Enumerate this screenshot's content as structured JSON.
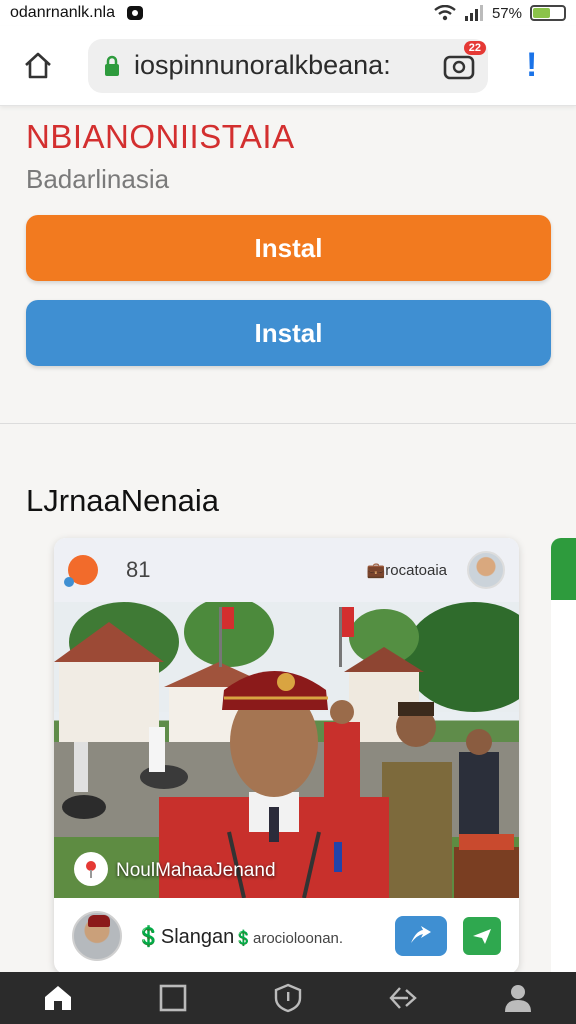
{
  "status_bar": {
    "left_text": "odanrnanlk.nla",
    "battery_text": "57%",
    "battery_level": 0.57
  },
  "browser": {
    "url": "iospinnunoralkbeana:",
    "tab_count": "22",
    "menu_glyph": "!"
  },
  "page": {
    "title": "NBIANONIISTAIA",
    "subtitle": "Badarlinasia",
    "install_orange_label": "Instal",
    "install_blue_label": "Instal",
    "section_title": "LJrnaaNenaia"
  },
  "card": {
    "count": "81",
    "tag": "💼rocatoaia",
    "photo_caption": "NoulMahaaJenand",
    "footer_name": "💲Slangan",
    "footer_detail": "💲arocioloonan."
  },
  "colors": {
    "title_red": "#d32f2f",
    "orange_button": "#f27a1f",
    "blue_button": "#3f8fd2",
    "green_accent": "#2fa84f"
  },
  "icons": {
    "home": "home-icon",
    "lock": "lock-icon",
    "tabs": "tabs-icon",
    "share": "share-icon",
    "message": "message-icon",
    "nav": [
      "home-icon",
      "square-icon",
      "shield-icon",
      "back-icon",
      "profile-icon"
    ]
  }
}
